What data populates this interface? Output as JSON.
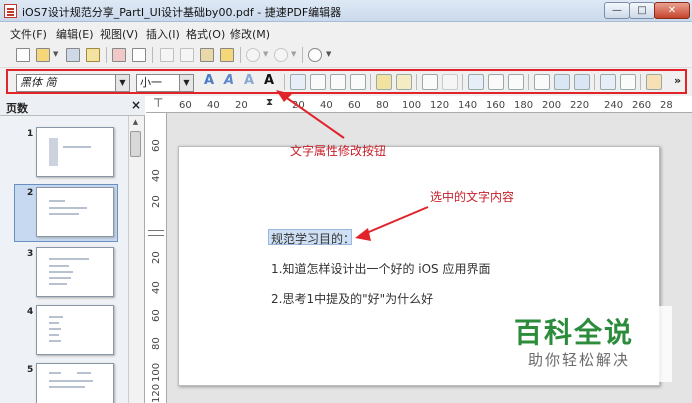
{
  "window": {
    "title": "iOS7设计规范分享_PartI_UI设计基础by00.pdf - 捷速PDF编辑器",
    "min_glyph": "—",
    "max_glyph": "□",
    "close_glyph": "✕"
  },
  "menu": [
    "文件(F)",
    "编辑(E)",
    "视图(V)",
    "插入(I)",
    "格式(O)",
    "修改(M)"
  ],
  "format_toolbar": {
    "font_name": "黑体 简",
    "font_size": "小一",
    "text_button_glyph": "A",
    "overflow": "»"
  },
  "panel": {
    "title": "页数",
    "close": "×",
    "pages": [
      "1",
      "2",
      "3",
      "4",
      "5"
    ],
    "selected_page": "2"
  },
  "ruler": {
    "top": [
      "60",
      "40",
      "20",
      "20",
      "40",
      "60",
      "80",
      "100",
      "120",
      "140",
      "160",
      "180",
      "200",
      "220",
      "240",
      "260",
      "28"
    ],
    "left": [
      "60",
      "40",
      "20",
      "20",
      "40",
      "60",
      "80",
      "100",
      "120"
    ]
  },
  "document": {
    "selected_heading": "规范学习目的：",
    "line1": "1.知道怎样设计出一个好的 iOS 应用界面",
    "line2": "2.思考1中提及的\"好\"为什么好"
  },
  "annotations": {
    "button_label": "文字属性修改按钮",
    "selection_label": "选中的文字内容"
  },
  "watermark": {
    "title": "百科全说",
    "subtitle": "助你轻松解决"
  },
  "colors": {
    "annotation_red": "#e0242a",
    "watermark_green": "#2c8c3c"
  }
}
